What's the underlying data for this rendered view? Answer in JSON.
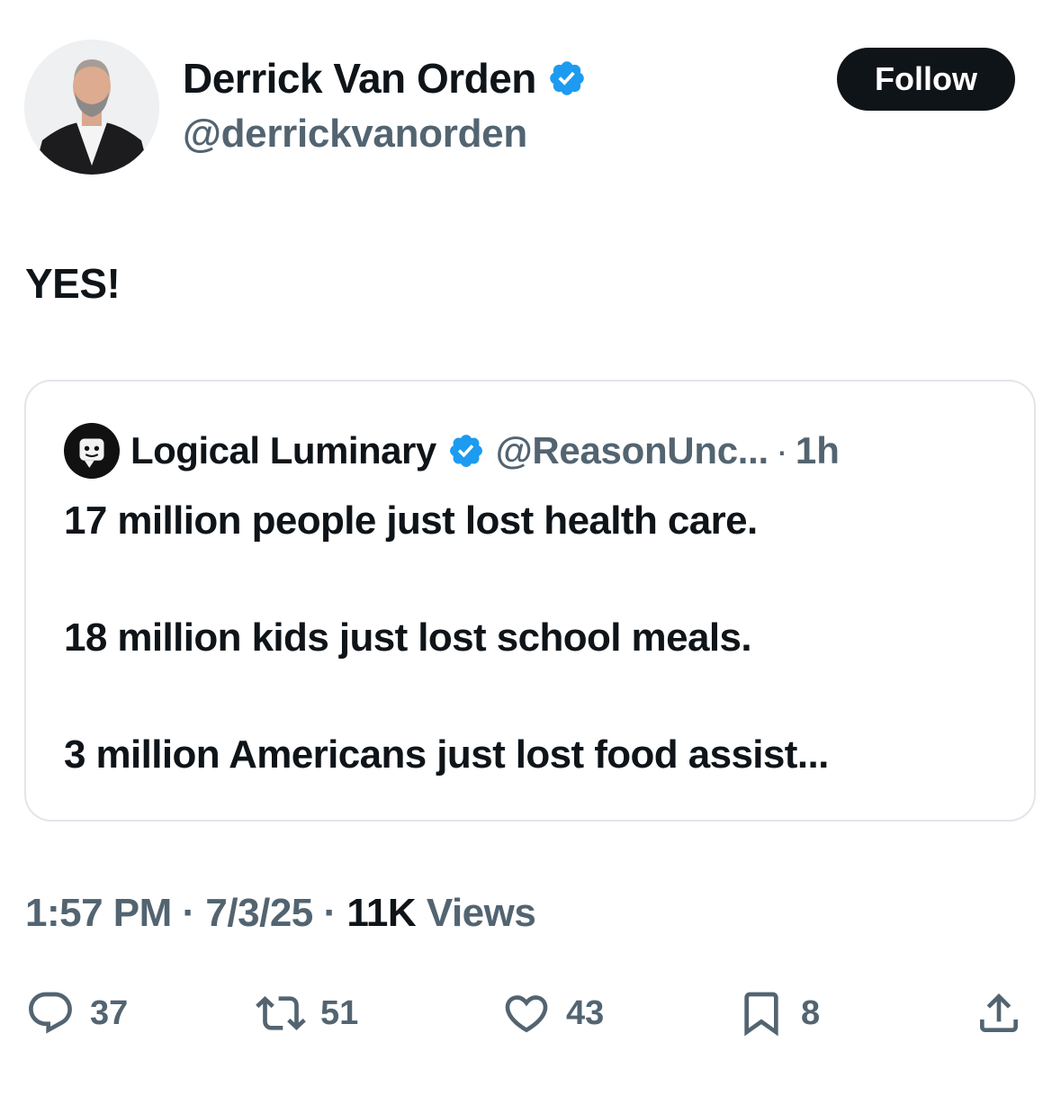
{
  "author": {
    "display_name": "Derrick Van Orden",
    "handle": "@derrickvanorden",
    "verified": true
  },
  "follow_label": "Follow",
  "tweet_text": "YES!",
  "quote": {
    "display_name": "Logical Luminary",
    "handle": "@ReasonUnc...",
    "separator": "·",
    "time": "1h",
    "lines": [
      "17 million people just lost health care.",
      "18 million kids just lost school meals.",
      "3 million Americans just lost food assist..."
    ]
  },
  "meta": {
    "time": "1:57 PM",
    "date": "7/3/25",
    "views_count": "11K",
    "views_label": "Views",
    "separator": "·"
  },
  "actions": {
    "replies": "37",
    "reposts": "51",
    "likes": "43",
    "bookmarks": "8"
  },
  "colors": {
    "verified_blue": "#1d9bf0",
    "secondary_text": "#536471",
    "primary_text": "#0f1419"
  },
  "icons": [
    "verified-badge-icon",
    "reply-icon",
    "retweet-icon",
    "heart-icon",
    "bookmark-icon",
    "share-icon"
  ]
}
